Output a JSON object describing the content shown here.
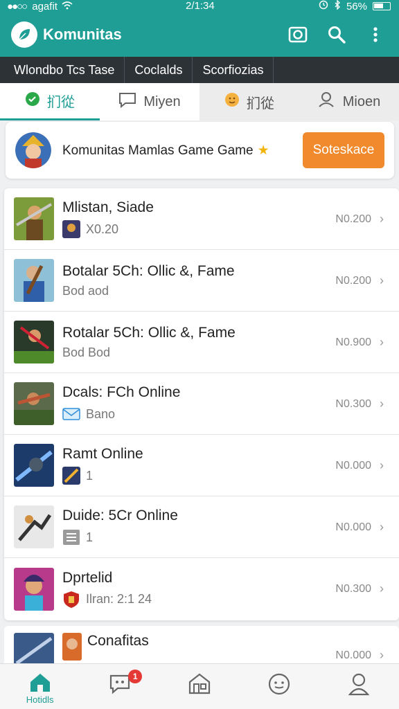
{
  "status": {
    "carrier": "agafit",
    "time": "2/1:34",
    "battery": "56%"
  },
  "app": {
    "title": "Komunitas",
    "brand_color": "#1f9e95"
  },
  "categories": [
    "Wlondbo Tcs Tase",
    "Coclalds",
    "Scorfiozias"
  ],
  "tabs": [
    {
      "label": "扪從",
      "icon": "chat-bubble-icon"
    },
    {
      "label": "Miyen",
      "icon": "message-icon"
    },
    {
      "label": "扪從",
      "icon": "emoji-icon"
    },
    {
      "label": "Mioen",
      "icon": "person-icon"
    }
  ],
  "banner": {
    "text": "Komunitas Mamlas Game Game",
    "button": "Soteskace",
    "button_color": "#f08a2c"
  },
  "games": [
    {
      "title": "Mlistan, Siade",
      "sub": "X0.20",
      "value": "N0.200"
    },
    {
      "title": "Botalar 5Ch: Ollic &, Fame",
      "sub": "Bod aod",
      "value": "N0.200"
    },
    {
      "title": "Rotalar 5Ch: Ollic &, Fame",
      "sub": "Bod Bod",
      "value": "N0.900"
    },
    {
      "title": "Dcals: FCh Online",
      "sub": "Bano",
      "value": "N0.300"
    },
    {
      "title": "Ramt Online",
      "sub": "1",
      "value": "N0.000"
    },
    {
      "title": "Duide: 5Cr Online",
      "sub": "1",
      "value": "N0.000"
    },
    {
      "title": "Dprtelid",
      "sub": "Ilran: 2:1 24",
      "value": "N0.300"
    }
  ],
  "peek": {
    "title": "Conafitas",
    "value": "N0.000"
  },
  "nav": {
    "home_label": "Hotidls",
    "badge": "1"
  }
}
